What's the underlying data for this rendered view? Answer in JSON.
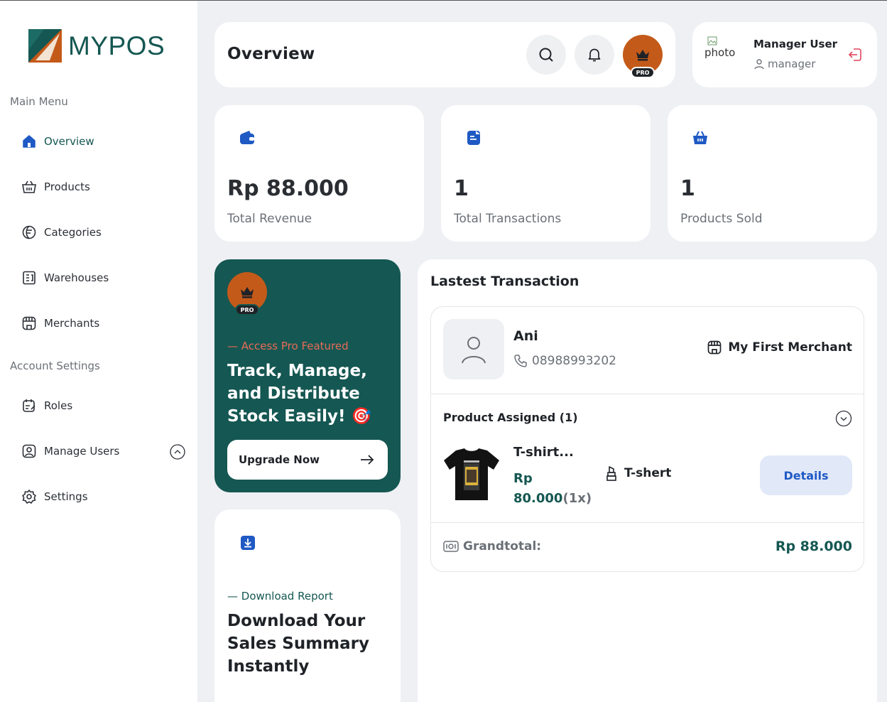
{
  "app": {
    "logo_text": "MYPOS"
  },
  "sidebar": {
    "main_menu_title": "Main Menu",
    "main_items": [
      {
        "label": "Overview",
        "icon": "home-icon",
        "active": true
      },
      {
        "label": "Products",
        "icon": "basket-icon"
      },
      {
        "label": "Categories",
        "icon": "category-icon"
      },
      {
        "label": "Warehouses",
        "icon": "warehouse-icon"
      },
      {
        "label": "Merchants",
        "icon": "shop-icon"
      }
    ],
    "account_title": "Account Settings",
    "account_items": [
      {
        "label": "Roles",
        "icon": "calendar-edit-icon"
      },
      {
        "label": "Manage Users",
        "icon": "user-square-icon"
      },
      {
        "label": "Settings",
        "icon": "gear-icon"
      }
    ]
  },
  "header": {
    "title": "Overview",
    "pro_badge": "PRO"
  },
  "user": {
    "photo_alt": "photo",
    "name": "Manager User",
    "role": "manager"
  },
  "stats": [
    {
      "value": "Rp 88.000",
      "label": "Total Revenue",
      "icon": "wallet-icon"
    },
    {
      "value": "1",
      "label": "Total Transactions",
      "icon": "receipt-icon"
    },
    {
      "value": "1",
      "label": "Products Sold",
      "icon": "basket-icon"
    }
  ],
  "pro_card": {
    "badge": "PRO",
    "eyebrow": "— Access Pro Featured",
    "heading": "Track, Manage, and Distribute Stock Easily! 🎯",
    "button": "Upgrade Now"
  },
  "download_card": {
    "eyebrow": "— Download Report",
    "heading": "Download Your Sales Summary Instantly"
  },
  "transaction": {
    "title": "Lastest Transaction",
    "customer_name": "Ani",
    "phone": "08988993202",
    "merchant": "My First Merchant",
    "assigned_label": "Product Assigned (1)",
    "product_name": "T-shirt...",
    "price_prefix": "Rp",
    "price": "80.000",
    "qty": "(1x)",
    "category": "T-shert",
    "details_button": "Details",
    "grandtotal_label": "Grandtotal:",
    "grandtotal_value": "Rp 88.000"
  },
  "colors": {
    "brand": "#155752",
    "accent_blue": "#1f59c4",
    "pro_orange": "#c45a19",
    "logout_red": "#e0455b"
  }
}
